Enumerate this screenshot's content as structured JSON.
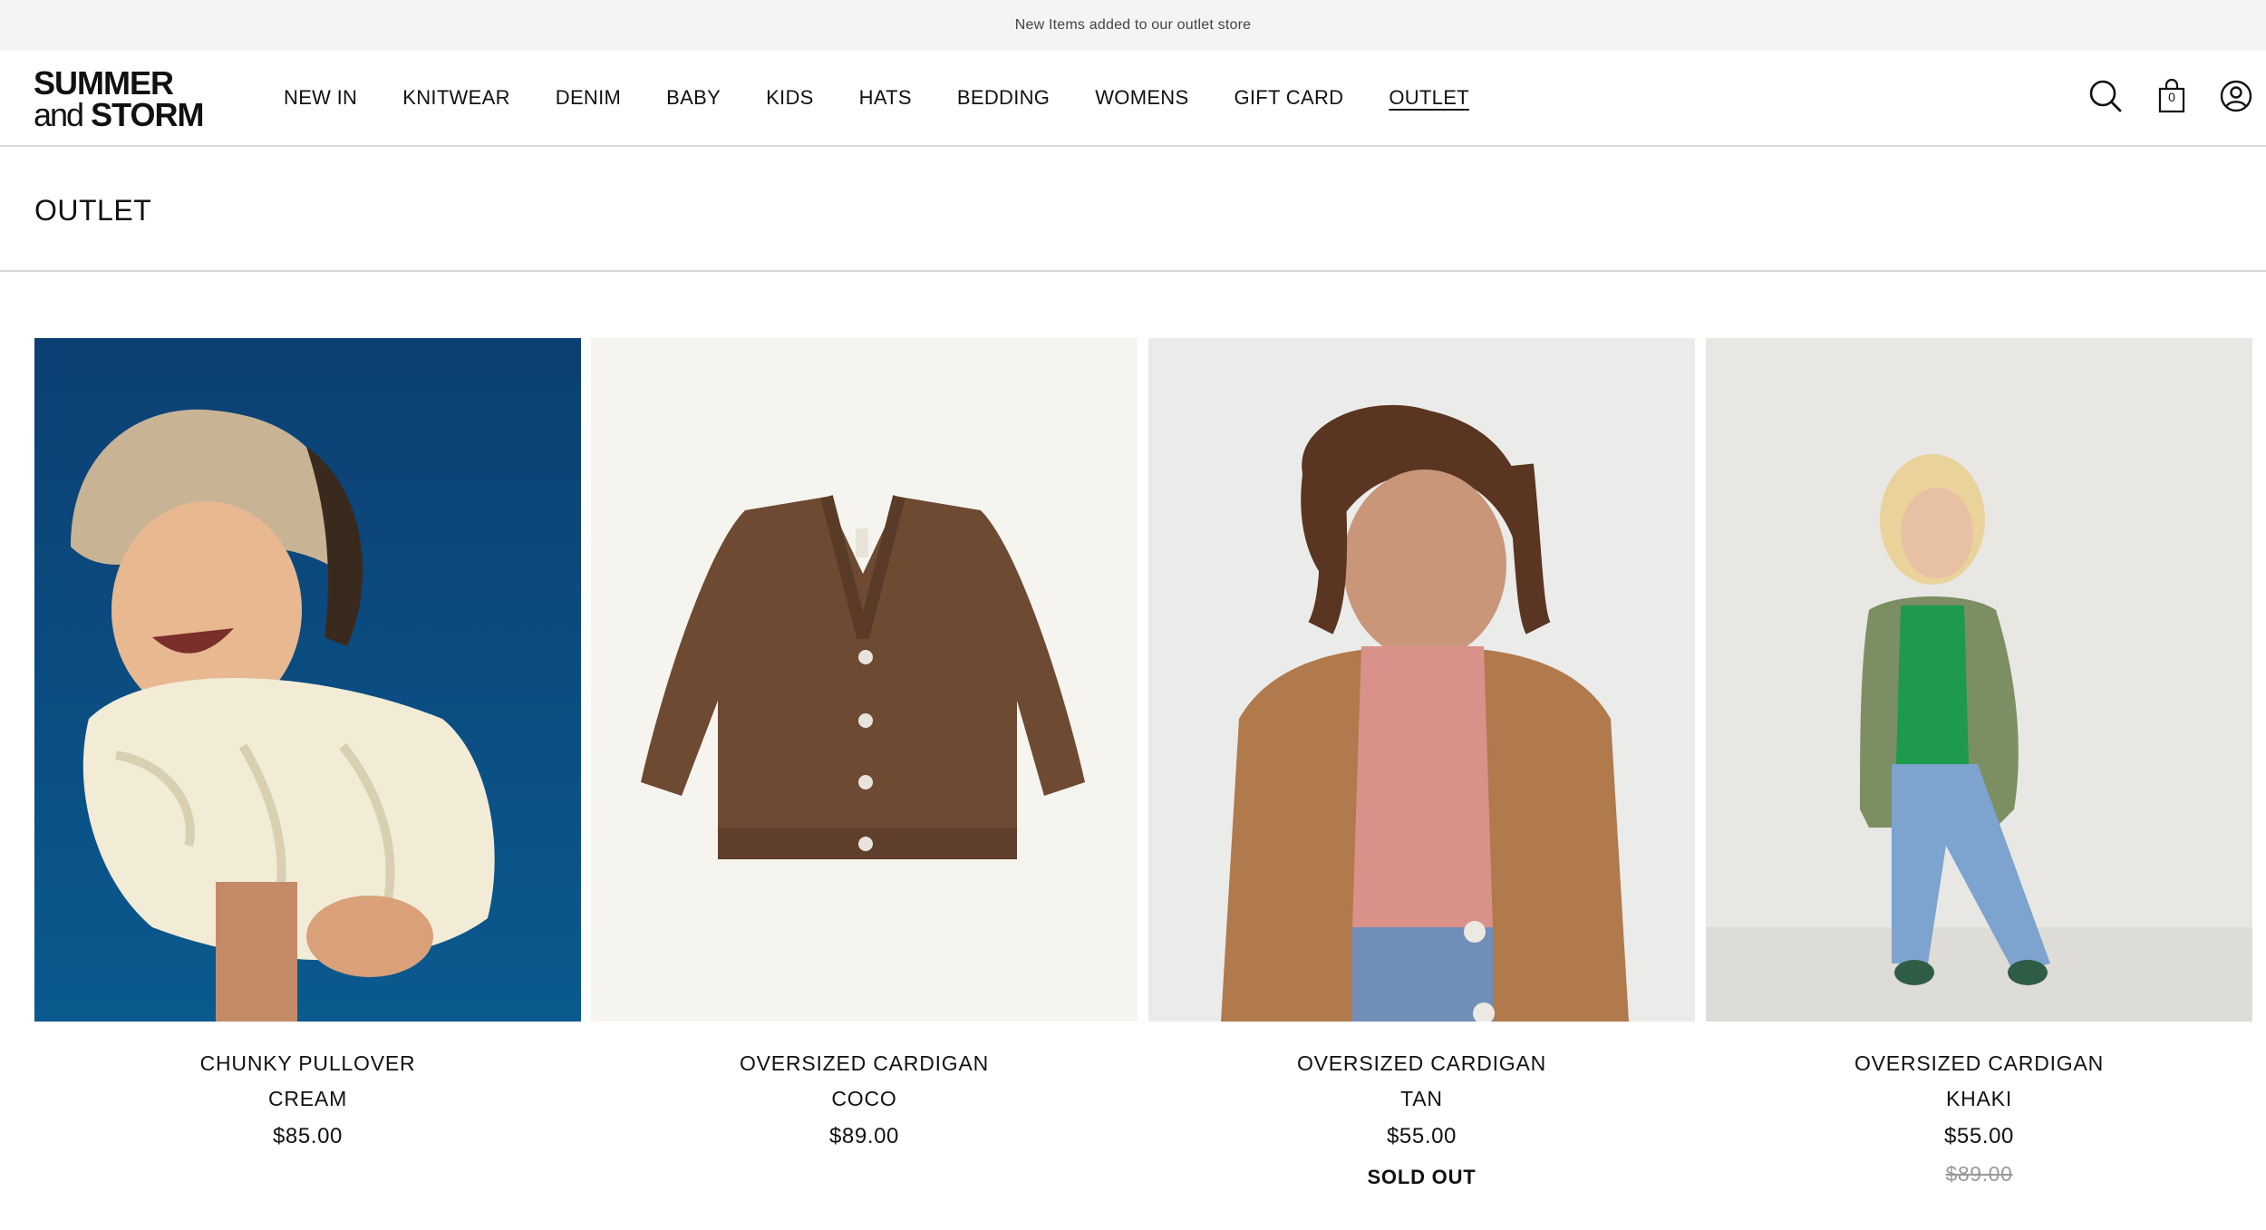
{
  "announcement": "New Items added to our outlet store",
  "header": {
    "logo": {
      "line1": "SUMMER",
      "line2_a": "and",
      "line2_b": "STORM"
    },
    "nav": [
      {
        "label": "NEW IN"
      },
      {
        "label": "KNITWEAR"
      },
      {
        "label": "DENIM"
      },
      {
        "label": "BABY"
      },
      {
        "label": "KIDS"
      },
      {
        "label": "HATS"
      },
      {
        "label": "BEDDING"
      },
      {
        "label": "WOMENS"
      },
      {
        "label": "GIFT CARD"
      },
      {
        "label": "OUTLET",
        "active": true
      }
    ],
    "icons": {
      "search": "search-icon",
      "cart": "shopping-bag-icon",
      "account": "user-account-icon"
    },
    "cart_count": "0"
  },
  "page": {
    "title": "OUTLET"
  },
  "products": [
    {
      "name": "CHUNKY PULLOVER",
      "color": "CREAM",
      "price": "$85.00",
      "image": "child-laughing-cream-sweater-photo"
    },
    {
      "name": "OVERSIZED CARDIGAN",
      "color": "COCO",
      "price": "$89.00",
      "image": "brown-cardigan-flatlay-photo"
    },
    {
      "name": "OVERSIZED CARDIGAN",
      "color": "TAN",
      "price": "$55.00",
      "badge": "SOLD OUT",
      "image": "child-tan-cardigan-photo"
    },
    {
      "name": "OVERSIZED CARDIGAN",
      "color": "KHAKI",
      "price": "$55.00",
      "compare_price": "$89.00",
      "image": "child-khaki-cardigan-photo"
    }
  ],
  "colors": {
    "announcement_bg": "#f4f4f2",
    "divider": "#d9d9d9",
    "text": "#111111",
    "compare_price": "#999999"
  }
}
